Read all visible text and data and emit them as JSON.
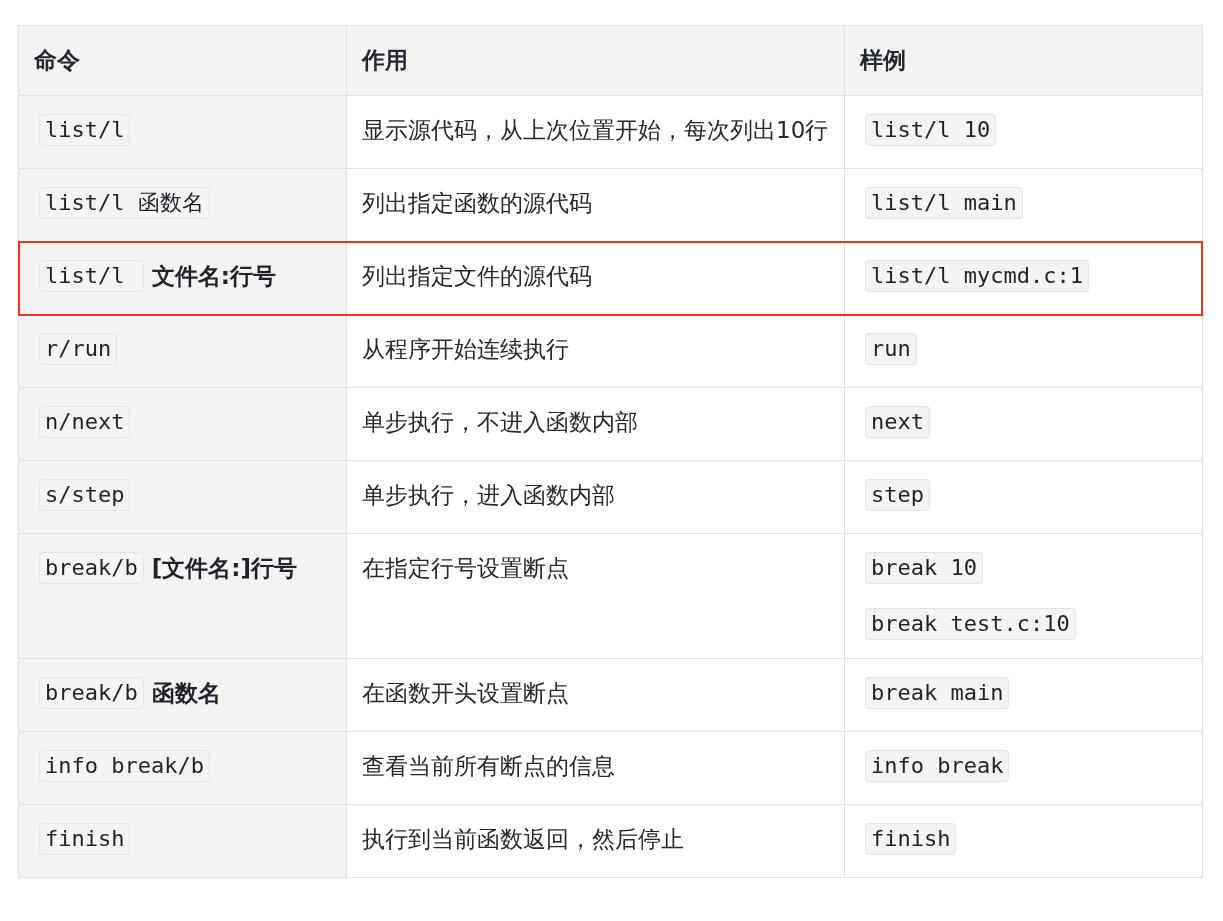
{
  "table": {
    "columns": [
      "命令",
      "作用",
      "样例"
    ],
    "rows": [
      {
        "highlighted": false,
        "command": [
          {
            "kind": "code",
            "text": "list/l"
          }
        ],
        "description": "显示源代码，从上次位置开始，每次列出10行",
        "examples": [
          "list/l 10"
        ]
      },
      {
        "highlighted": false,
        "command": [
          {
            "kind": "code",
            "text": "list/l 函数名"
          }
        ],
        "description": "列出指定函数的源代码",
        "examples": [
          "list/l main"
        ]
      },
      {
        "highlighted": true,
        "command": [
          {
            "kind": "code",
            "text": "list/l "
          },
          {
            "kind": "bold",
            "text": "文件名:行号"
          }
        ],
        "description": "列出指定文件的源代码",
        "examples": [
          "list/l mycmd.c:1"
        ]
      },
      {
        "highlighted": false,
        "command": [
          {
            "kind": "code",
            "text": "r/run"
          }
        ],
        "description": "从程序开始连续执行",
        "examples": [
          "run"
        ]
      },
      {
        "highlighted": false,
        "command": [
          {
            "kind": "code",
            "text": "n/next"
          }
        ],
        "description": "单步执行，不进入函数内部",
        "examples": [
          "next"
        ]
      },
      {
        "highlighted": false,
        "command": [
          {
            "kind": "code",
            "text": "s/step"
          }
        ],
        "description": "单步执行，进入函数内部",
        "examples": [
          "step"
        ]
      },
      {
        "highlighted": false,
        "command": [
          {
            "kind": "code",
            "text": "break/b"
          },
          {
            "kind": "bold",
            "text": "[文件名:]行号"
          }
        ],
        "description": "在指定行号设置断点",
        "examples": [
          "break 10",
          "break test.c:10"
        ]
      },
      {
        "highlighted": false,
        "command": [
          {
            "kind": "code",
            "text": "break/b"
          },
          {
            "kind": "bold",
            "text": "函数名"
          }
        ],
        "description": "在函数开头设置断点",
        "examples": [
          "break main"
        ]
      },
      {
        "highlighted": false,
        "command": [
          {
            "kind": "code",
            "text": "info break/b"
          }
        ],
        "description": "查看当前所有断点的信息",
        "examples": [
          "info break"
        ]
      },
      {
        "highlighted": false,
        "command": [
          {
            "kind": "code",
            "text": "finish"
          }
        ],
        "description": "执行到当前函数返回，然后停止",
        "examples": [
          "finish"
        ]
      }
    ]
  }
}
